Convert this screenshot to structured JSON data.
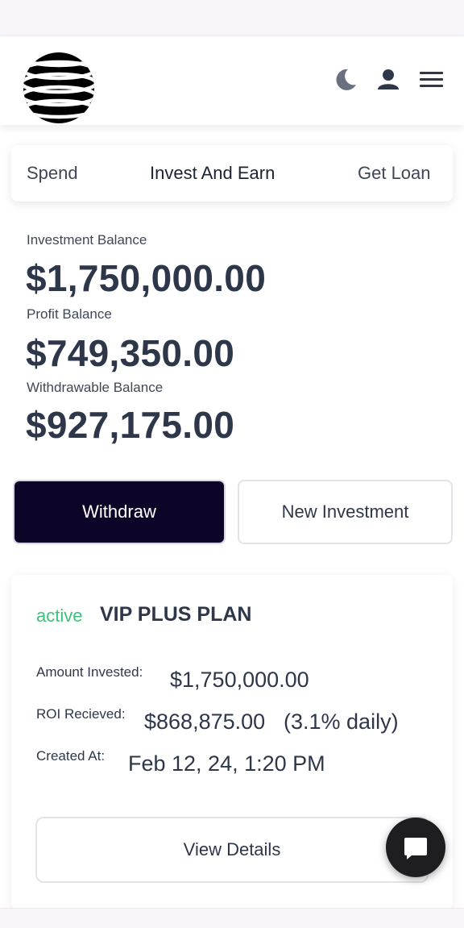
{
  "nav": {
    "tabs": [
      {
        "label": "Spend"
      },
      {
        "label": "Invest And Earn"
      },
      {
        "label": "Get Loan"
      }
    ]
  },
  "header_icons": [
    "logo-globe",
    "moon-icon",
    "user-icon",
    "hamburger-menu-icon"
  ],
  "balances": [
    {
      "label": "Investment Balance",
      "value": "$1,750,000.00"
    },
    {
      "label": "Profit Balance",
      "value": "$749,350.00"
    },
    {
      "label": "Withdrawable Balance",
      "value": "$927,175.00"
    }
  ],
  "actions": {
    "withdraw": "Withdraw",
    "new_investment": "New Investment"
  },
  "investment": {
    "status": "active",
    "plan": "VIP PLUS PLAN",
    "amount_label": "Amount Invested:",
    "amount_value": "$1,750,000.00",
    "roi_label": "ROI Recieved:",
    "roi_value": "$868,875.00",
    "roi_rate": "(3.1% daily)",
    "created_label": "Created At:",
    "created_value": "Feb 12, 24, 1:20 PM",
    "view_button": "View Details"
  },
  "chat_icon": "chat-bubble-icon",
  "colors": {
    "primary_button": "#0e0427",
    "status_active": "#3cc27a",
    "text": "#2e3749"
  }
}
